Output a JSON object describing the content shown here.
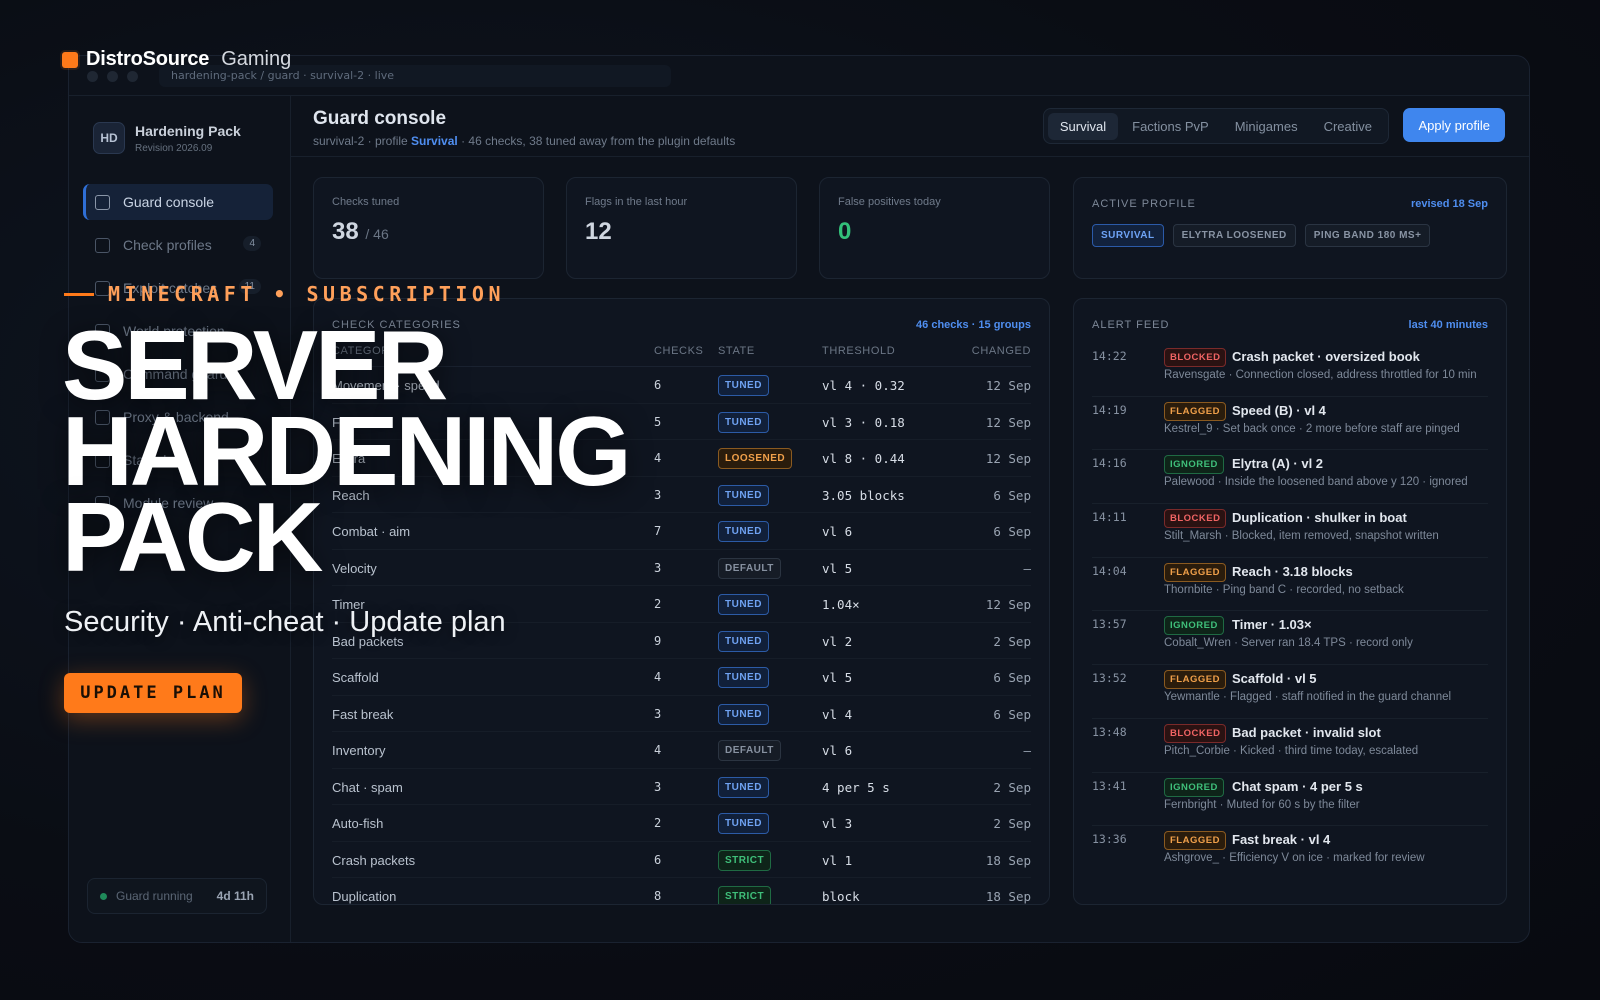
{
  "brand": {
    "name": "DistroSource",
    "sub": "Gaming"
  },
  "urlbar": "hardening-pack / guard · survival-2 · live",
  "workspace": {
    "initials": "HD",
    "name": "Hardening Pack",
    "revision": "Revision 2026.09"
  },
  "sidebar": {
    "items": [
      {
        "label": "Guard console",
        "active": true
      },
      {
        "label": "Check profiles",
        "count": "4"
      },
      {
        "label": "Exploit catches",
        "count": "11"
      },
      {
        "label": "World protection"
      },
      {
        "label": "Command guard"
      },
      {
        "label": "Proxy & backend"
      },
      {
        "label": "Staff alerts"
      },
      {
        "label": "Module review"
      }
    ],
    "status": {
      "label": "Guard running",
      "uptime": "4d 11h"
    }
  },
  "header": {
    "title": "Guard console",
    "subtitle_prefix": "survival-2 · profile ",
    "subtitle_profile": "Survival",
    "subtitle_suffix": " · 46 checks, 38 tuned away from the plugin defaults",
    "tabs": [
      {
        "label": "Survival",
        "active": true
      },
      {
        "label": "Factions PvP"
      },
      {
        "label": "Minigames"
      },
      {
        "label": "Creative"
      }
    ],
    "apply_label": "Apply profile"
  },
  "stats": [
    {
      "label": "Checks tuned",
      "value": "38",
      "of": "/ 46"
    },
    {
      "label": "Flags in the last hour",
      "value": "12"
    },
    {
      "label": "False positives today",
      "value": "0"
    }
  ],
  "active_profile": {
    "label": "ACTIVE PROFILE",
    "revised": "revised 18 Sep",
    "chips": [
      "SURVIVAL",
      "ELYTRA LOOSENED",
      "PING BAND 180 MS+"
    ]
  },
  "categories": {
    "title": "CHECK CATEGORIES",
    "meta": "46 checks · 15 groups",
    "columns": {
      "name": "CATEGORY",
      "checks": "CHECKS",
      "state": "STATE",
      "threshold": "THRESHOLD",
      "changed": "CHANGED"
    },
    "rows": [
      {
        "name": "Movement · speed",
        "checks": "6",
        "state": "TUNED",
        "threshold": "vl 4 · 0.32",
        "changed": "12 Sep"
      },
      {
        "name": "Flight",
        "checks": "5",
        "state": "TUNED",
        "threshold": "vl 3 · 0.18",
        "changed": "12 Sep"
      },
      {
        "name": "Elytra",
        "checks": "4",
        "state": "LOOSENED",
        "threshold": "vl 8 · 0.44",
        "changed": "12 Sep"
      },
      {
        "name": "Reach",
        "checks": "3",
        "state": "TUNED",
        "threshold": "3.05 blocks",
        "changed": "6 Sep"
      },
      {
        "name": "Combat · aim",
        "checks": "7",
        "state": "TUNED",
        "threshold": "vl 6",
        "changed": "6 Sep"
      },
      {
        "name": "Velocity",
        "checks": "3",
        "state": "DEFAULT",
        "threshold": "vl 5",
        "changed": "–"
      },
      {
        "name": "Timer",
        "checks": "2",
        "state": "TUNED",
        "threshold": "1.04×",
        "changed": "12 Sep"
      },
      {
        "name": "Bad packets",
        "checks": "9",
        "state": "TUNED",
        "threshold": "vl 2",
        "changed": "2 Sep"
      },
      {
        "name": "Scaffold",
        "checks": "4",
        "state": "TUNED",
        "threshold": "vl 5",
        "changed": "6 Sep"
      },
      {
        "name": "Fast break",
        "checks": "3",
        "state": "TUNED",
        "threshold": "vl 4",
        "changed": "6 Sep"
      },
      {
        "name": "Inventory",
        "checks": "4",
        "state": "DEFAULT",
        "threshold": "vl 6",
        "changed": "–"
      },
      {
        "name": "Chat · spam",
        "checks": "3",
        "state": "TUNED",
        "threshold": "4 per 5 s",
        "changed": "2 Sep"
      },
      {
        "name": "Auto-fish",
        "checks": "2",
        "state": "TUNED",
        "threshold": "vl 3",
        "changed": "2 Sep"
      },
      {
        "name": "Crash packets",
        "checks": "6",
        "state": "STRICT",
        "threshold": "vl 1",
        "changed": "18 Sep"
      },
      {
        "name": "Duplication",
        "checks": "8",
        "state": "STRICT",
        "threshold": "block",
        "changed": "18 Sep"
      }
    ]
  },
  "alert_feed": {
    "title": "ALERT FEED",
    "meta": "last 40 minutes",
    "alerts": [
      {
        "time": "14:22",
        "type": "BLOCKED",
        "title": "Crash packet · oversized book",
        "detail": "Ravensgate · Connection closed, address throttled for 10 min"
      },
      {
        "time": "14:19",
        "type": "FLAGGED",
        "title": "Speed (B) · vl 4",
        "detail": "Kestrel_9 · Set back once · 2 more before staff are pinged"
      },
      {
        "time": "14:16",
        "type": "IGNORED",
        "title": "Elytra (A) · vl 2",
        "detail": "Palewood · Inside the loosened band above y 120 · ignored"
      },
      {
        "time": "14:11",
        "type": "BLOCKED",
        "title": "Duplication · shulker in boat",
        "detail": "Stilt_Marsh · Blocked, item removed, snapshot written"
      },
      {
        "time": "14:04",
        "type": "FLAGGED",
        "title": "Reach · 3.18 blocks",
        "detail": "Thornbite · Ping band C · recorded, no setback"
      },
      {
        "time": "13:57",
        "type": "IGNORED",
        "title": "Timer · 1.03×",
        "detail": "Cobalt_Wren · Server ran 18.4 TPS · record only"
      },
      {
        "time": "13:52",
        "type": "FLAGGED",
        "title": "Scaffold · vl 5",
        "detail": "Yewmantle · Flagged · staff notified in the guard channel"
      },
      {
        "time": "13:48",
        "type": "BLOCKED",
        "title": "Bad packet · invalid slot",
        "detail": "Pitch_Corbie · Kicked · third time today, escalated"
      },
      {
        "time": "13:41",
        "type": "IGNORED",
        "title": "Chat spam · 4 per 5 s",
        "detail": "Fernbright · Muted for 60 s by the filter"
      },
      {
        "time": "13:36",
        "type": "FLAGGED",
        "title": "Fast break · vl 4",
        "detail": "Ashgrove_ · Efficiency V on ice · marked for review"
      }
    ]
  },
  "hero": {
    "eyebrow": "MINECRAFT • SUBSCRIPTION",
    "title_lines": [
      "SERVER",
      "HARDENING",
      "PACK"
    ],
    "subtitle": "Security · Anti-cheat · Update plan",
    "cta": "UPDATE PLAN"
  },
  "colors": {
    "accent": "#ff7a1a",
    "primary": "#3f86ee",
    "background": "#0a0d14",
    "success": "#33c07a"
  }
}
